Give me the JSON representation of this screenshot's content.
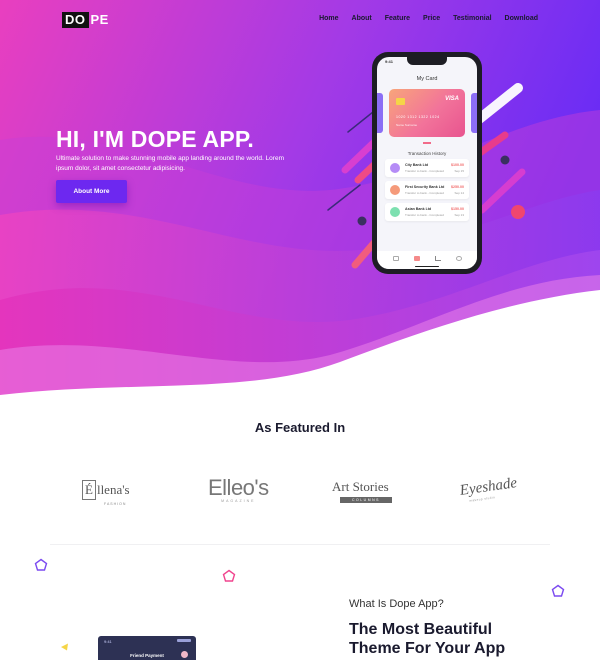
{
  "nav": {
    "logo_box": "DO",
    "logo_rest": "PE",
    "items": [
      "Home",
      "About",
      "Feature",
      "Price",
      "Testimonial",
      "Download"
    ]
  },
  "hero": {
    "title": "HI, I'M DOPE APP.",
    "description": "Ultimate solution to make stunning mobile app landing around the world. Lorem ipsum dolor, sit amet consectetur adipisicing.",
    "button_label": "About More"
  },
  "phone": {
    "status_time": "9:41",
    "screen_title": "My Card",
    "card": {
      "brand": "VISA",
      "number": "1020  1312  1322  1024",
      "holder": "Name Surname"
    },
    "history_title": "Transaction History",
    "transactions": [
      {
        "name": "City Bank Ltd",
        "sub": "Transfer to bank - Completed",
        "amount": "$100.00",
        "date": "Sep 15",
        "color": "#b58cf6"
      },
      {
        "name": "First Security Bank Ltd",
        "sub": "Transfer to bank - Completed",
        "amount": "$250.00",
        "date": "Sep 14",
        "color": "#f59a7a"
      },
      {
        "name": "Asian Bank Ltd",
        "sub": "Transfer to bank - Completed",
        "amount": "$150.00",
        "date": "Sep 13",
        "color": "#7de0b0"
      }
    ]
  },
  "featured": {
    "title": "As Featured In",
    "brands": [
      {
        "box": "É",
        "text": "llena's",
        "sub": "FASHION"
      },
      {
        "text": "Elleo's",
        "sub": "MAGAZINE"
      },
      {
        "text": "Art Stories",
        "sub": "COLUMNS"
      },
      {
        "text": "Eyeshade",
        "sub": "makeup studio"
      }
    ]
  },
  "about": {
    "kicker": "What Is Dope App?",
    "title_line1": "The Most Beautiful",
    "title_line2": "Theme For Your App"
  },
  "mini_phone": {
    "time": "9:41",
    "title": "Friend Payment"
  },
  "colors": {
    "hero_start": "#e93fbf",
    "hero_end": "#6a2cf5",
    "accent": "#6d28f0"
  }
}
